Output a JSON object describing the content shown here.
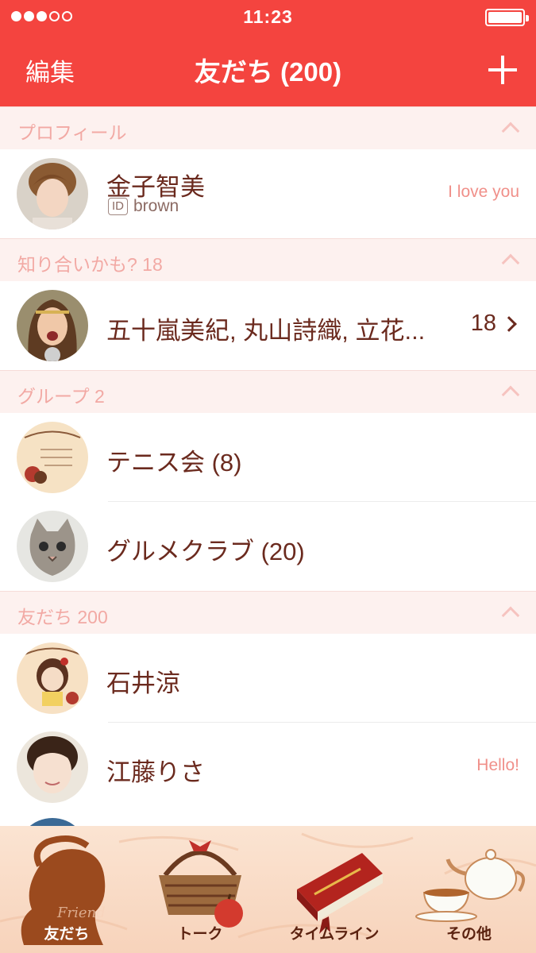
{
  "status_bar": {
    "time": "11:23",
    "signal_strength": 3,
    "signal_max": 5
  },
  "header": {
    "edit_label": "編集",
    "title": "友だち (200)",
    "add_icon": "plus-icon"
  },
  "sections": {
    "profile": {
      "label": "プロフィール"
    },
    "suggested": {
      "label": "知り合いかも? 18"
    },
    "groups": {
      "label": "グループ 2"
    },
    "friends": {
      "label": "友だち 200"
    }
  },
  "profile": {
    "name": "金子智美",
    "id_badge": "ID",
    "user_id": "brown",
    "status": "I love you"
  },
  "suggested": {
    "names": "五十嵐美紀, 丸山詩織, 立花...",
    "count": "18"
  },
  "groups": [
    {
      "name": "テニス会 (8)"
    },
    {
      "name": "グルメクラブ (20)"
    }
  ],
  "friends": [
    {
      "name": "石井涼",
      "status": ""
    },
    {
      "name": "江藤りさ",
      "status": "Hello!"
    }
  ],
  "tabs": [
    {
      "label": "友だち",
      "icon": "silhouette-icon",
      "active": true
    },
    {
      "label": "トーク",
      "icon": "basket-icon",
      "active": false
    },
    {
      "label": "タイムライン",
      "icon": "book-icon",
      "active": false
    },
    {
      "label": "その他",
      "icon": "teapot-icon",
      "active": false
    }
  ],
  "colors": {
    "accent": "#f4443f",
    "section_bg": "#fdf1ef",
    "section_text": "#f2a9a4",
    "name_text": "#6b2a1e",
    "status_text": "#f0908a"
  }
}
